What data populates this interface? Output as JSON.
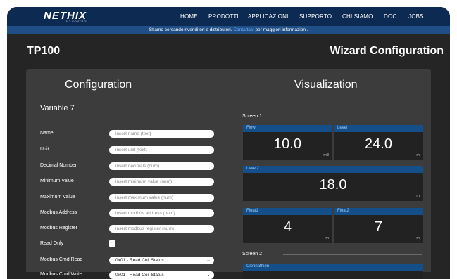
{
  "brand": {
    "logo": "NETHIX",
    "tagline": "M2 CONTROL"
  },
  "nav": [
    "HOME",
    "PRODOTTI",
    "APPLICAZIONI",
    "SUPPORTO",
    "CHI SIAMO",
    "DOC",
    "JOBS"
  ],
  "notice": {
    "before": "Stiamo cercando rivenditori e distributori.",
    "link": "Contattaci",
    "after": "per maggiori informazioni."
  },
  "page": {
    "product": "TP100",
    "heading": "Wizard Configuration"
  },
  "configuration": {
    "title": "Configuration",
    "variable_name": "Variable 7",
    "fields": [
      {
        "label": "Name",
        "placeholder": "insert name (text)"
      },
      {
        "label": "Unit",
        "placeholder": "insert unit (text)"
      },
      {
        "label": "Decimal Number",
        "placeholder": "insert decimals (num)"
      },
      {
        "label": "Minimum Value",
        "placeholder": "insert minimum value (num)"
      },
      {
        "label": "Maximum Value",
        "placeholder": "insert maximum value (num)"
      },
      {
        "label": "Modbus Address",
        "placeholder": "insert modbus address (num)"
      },
      {
        "label": "Modbus Register",
        "placeholder": "insert modbus register (num)"
      }
    ],
    "read_only": {
      "label": "Read Only",
      "checked": false
    },
    "selects": [
      {
        "label": "Modbus Cmd Read",
        "value": "0x01 - Read Coil Status"
      },
      {
        "label": "Modbus Cmd Write",
        "value": "0x01 - Read Coil Status"
      }
    ]
  },
  "visualization": {
    "title": "Visualization",
    "screens": [
      {
        "label": "Screen 1",
        "tiles": [
          {
            "name": "Flow",
            "value": "10.0",
            "unit": "m3"
          },
          {
            "name": "Level",
            "value": "24.0",
            "unit": "m"
          },
          {
            "name": "Level2",
            "value": "18.0",
            "unit": "m"
          },
          {
            "name": "Float1",
            "value": "4",
            "unit": "m"
          },
          {
            "name": "Float2",
            "value": "7",
            "unit": "m"
          }
        ]
      },
      {
        "label": "Screen 2",
        "tiles": [
          {
            "name": "Clorinathion"
          }
        ]
      }
    ]
  },
  "colors": {
    "topbar": "#0d2a52",
    "notice_bar": "#1f4f86",
    "tile_header": "#154f8a",
    "panel": "#3c3c3c"
  }
}
